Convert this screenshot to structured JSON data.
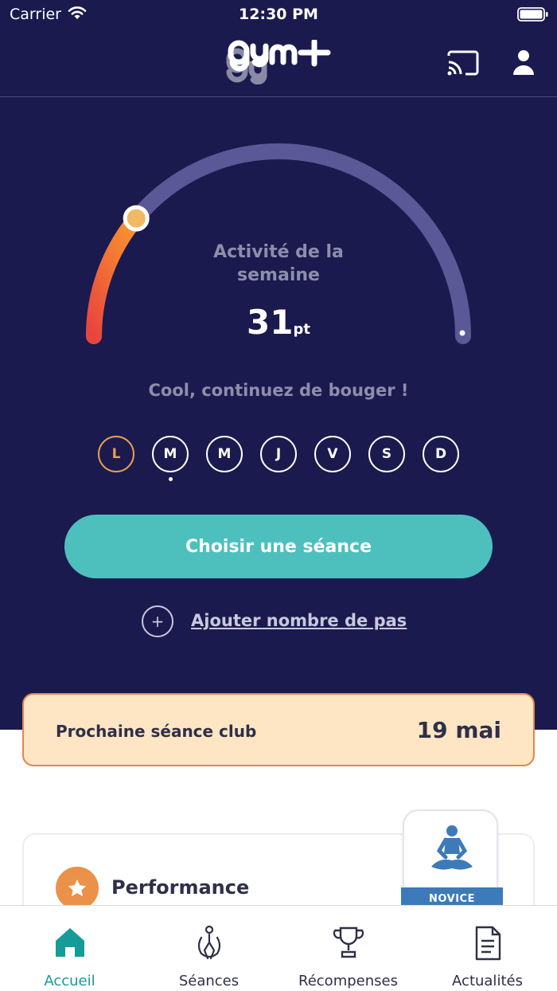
{
  "status_bar": {
    "carrier": "Carrier",
    "time": "12:30 PM"
  },
  "header": {
    "logo_text": "gym+",
    "icons": [
      "cast-icon",
      "user-icon"
    ]
  },
  "activity": {
    "label": "Activité de la semaine",
    "value": "31",
    "unit": "pt",
    "progress_fraction": 0.22,
    "message": "Cool, continuez de bouger !"
  },
  "week_days": [
    {
      "label": "L",
      "active": true
    },
    {
      "label": "M",
      "active": false,
      "today": true
    },
    {
      "label": "M",
      "active": false
    },
    {
      "label": "J",
      "active": false
    },
    {
      "label": "V",
      "active": false
    },
    {
      "label": "S",
      "active": false
    },
    {
      "label": "D",
      "active": false
    }
  ],
  "cta": {
    "label": "Choisir une séance"
  },
  "steps": {
    "plus_symbol": "+",
    "label": "Ajouter nombre de pas"
  },
  "next_club": {
    "label": "Prochaine séance club",
    "date": "19 mai"
  },
  "performance": {
    "title": "Performance",
    "badge_label": "NOVICE",
    "icon": "star-icon"
  },
  "tabbar": {
    "tabs": [
      {
        "label": "Accueil",
        "icon": "home-icon",
        "active": true
      },
      {
        "label": "Séances",
        "icon": "workout-icon",
        "active": false
      },
      {
        "label": "Récompenses",
        "icon": "trophy-icon",
        "active": false
      },
      {
        "label": "Actualités",
        "icon": "news-icon",
        "active": false
      }
    ]
  },
  "colors": {
    "background_dark": "#1b1a4e",
    "accent_teal": "#4dc0bd",
    "accent_orange": "#e9844b",
    "gauge_track": "#5a5896",
    "active_tab": "#159c98"
  }
}
